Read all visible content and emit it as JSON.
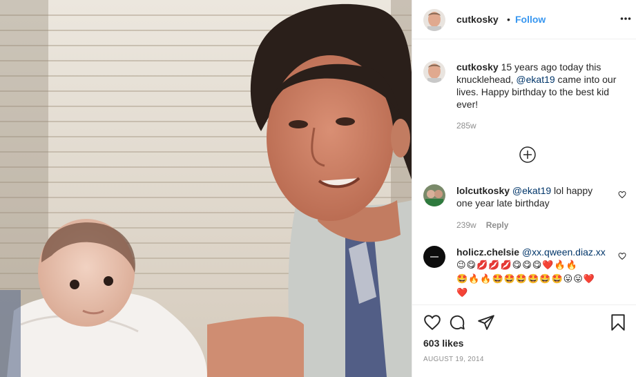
{
  "post": {
    "username": "cutkosky",
    "separator": "•",
    "follow_label": "Follow",
    "more_icon": "more-horizontal-icon"
  },
  "caption": {
    "username": "cutkosky",
    "text_before": " 15 years ago today this knucklehead, ",
    "mention": "@ekat19",
    "text_after": " came into our lives. Happy birthday to the best kid ever!",
    "time": "285w"
  },
  "load_more_icon": "plus-circle-icon",
  "comments": [
    {
      "username": "lolcutkosky",
      "mention": "@ekat19",
      "text": " lol happy one year late birthday",
      "time": "239w",
      "reply_label": "Reply"
    },
    {
      "username": "holicz.chelsie",
      "mention": "@xx.qween.diaz.xx",
      "emoji_line1": "😉😋💋💋💋😋😋😋❤️🔥🔥",
      "emoji_line2": "🤩🔥🔥🤩🤩🤩🤩🤩🤩😛😛❤️",
      "emoji_line3": "❤️"
    }
  ],
  "footer": {
    "likes": "603 likes",
    "date": "AUGUST 19, 2014",
    "icons": [
      "heart-icon",
      "comment-icon",
      "share-icon",
      "bookmark-icon"
    ]
  },
  "colors": {
    "link_blue": "#3897f0",
    "mention": "#003569",
    "muted": "#8e8e8e",
    "border": "#efefef"
  }
}
